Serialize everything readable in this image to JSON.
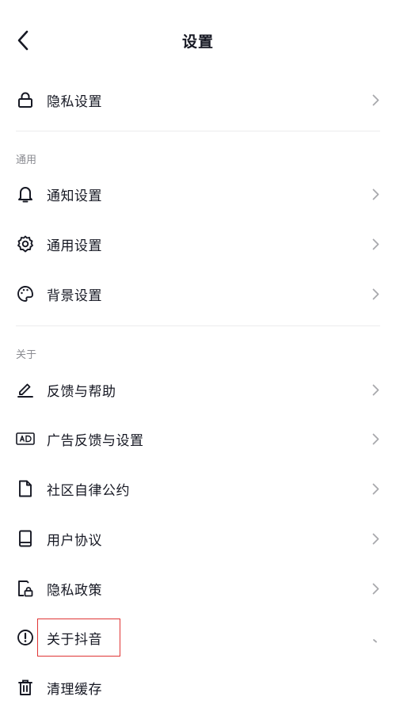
{
  "header": {
    "title": "设置"
  },
  "privacy_row": {
    "label": "隐私设置",
    "icon": "lock-icon"
  },
  "sections": {
    "general": {
      "heading": "通用",
      "items": [
        {
          "label": "通知设置",
          "icon": "bell-icon"
        },
        {
          "label": "通用设置",
          "icon": "gear-icon"
        },
        {
          "label": "背景设置",
          "icon": "palette-icon"
        }
      ]
    },
    "about": {
      "heading": "关于",
      "items": [
        {
          "label": "反馈与帮助",
          "icon": "pen-icon"
        },
        {
          "label": "广告反馈与设置",
          "icon": "ad-icon"
        },
        {
          "label": "社区自律公约",
          "icon": "document-icon"
        },
        {
          "label": "用户协议",
          "icon": "book-icon"
        },
        {
          "label": "隐私政策",
          "icon": "privacy-policy-icon"
        },
        {
          "label": "关于抖音",
          "icon": "info-icon"
        },
        {
          "label": "清理缓存",
          "icon": "trash-icon"
        }
      ]
    }
  },
  "colors": {
    "text": "#161823",
    "secondary": "#8a8b91",
    "chevron": "#a8a9ad",
    "highlight": "#e03535"
  }
}
